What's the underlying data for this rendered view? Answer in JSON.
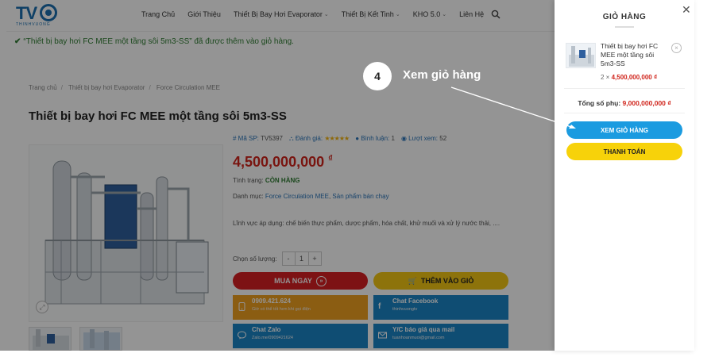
{
  "header": {
    "logo_text": "TV",
    "logo_sub": "THINHVUONG",
    "nav": [
      {
        "label": "Trang Chủ",
        "caret": false
      },
      {
        "label": "Giới Thiệu",
        "caret": false
      },
      {
        "label": "Thiết Bị Bay Hơi Evaporator",
        "caret": true
      },
      {
        "label": "Thiết Bị Kết Tinh",
        "caret": true
      },
      {
        "label": "KHO 5.0",
        "caret": true
      },
      {
        "label": "Liên Hệ",
        "caret": false
      }
    ]
  },
  "notice": "“Thiết bị bay hơi FC MEE một tầng sôi 5m3-SS” đã được thêm vào giỏ hàng.",
  "breadcrumb": [
    "Trang chủ",
    "Thiết bị bay hơi Evaporator",
    "Force Circulation MEE"
  ],
  "product": {
    "title": "Thiết bị bay hơi FC MEE một tầng sôi 5m3-SS",
    "sku_label": "Mã SP:",
    "sku": "TV5397",
    "rating_label": "Đánh giá:",
    "rating_stars": "★★★★★",
    "comments_label": "Bình luận:",
    "comments": "1",
    "views_label": "Lượt xem:",
    "views": "52",
    "price": "4,500,000,000",
    "currency": "₫",
    "stock_label": "Tình trạng:",
    "stock": "CÒN HÀNG",
    "category_label": "Danh mục:",
    "categories": [
      "Force Circulation MEE",
      "Sản phẩm bán chạy"
    ],
    "description": "Lĩnh vực áp dụng: chế biến thực phẩm, dược phẩm, hóa chất, khử muối và xử lý nước thải, ....",
    "qty_label": "Chọn số lượng:",
    "qty": "1",
    "buy_label": "MUA NGAY",
    "add_label": "THÊM VÀO GIỎ"
  },
  "contacts": [
    {
      "title": "0909.421.624",
      "sub": "Giờ có thể tốt hơn khi gọi điện"
    },
    {
      "title": "Chat Facebook",
      "sub": "thinhvuongtv"
    },
    {
      "title": "Chat Zalo",
      "sub": "Zalo.me/0909421624"
    },
    {
      "title": "Y/C báo giá qua mail",
      "sub": "tuanhoanmuoi@gmail.com"
    }
  ],
  "cart": {
    "title": "GIỎ HÀNG",
    "item_name": "Thiết bị bay hơi FC MEE một tầng sôi 5m3-SS",
    "item_qty": "2 ×",
    "item_price": "4,500,000,000 ₫",
    "subtotal_label": "Tổng số phụ:",
    "subtotal": "9,000,000,000 ₫",
    "view_cart": "XEM GIỎ HÀNG",
    "checkout": "THANH TOÁN"
  },
  "callout": {
    "number": "4",
    "label": "Xem giỏ hàng"
  },
  "colors": {
    "accent_blue": "#1b9be0",
    "price_red": "#d0241b",
    "buy_red": "#d71f23",
    "yellow": "#f3c613"
  }
}
